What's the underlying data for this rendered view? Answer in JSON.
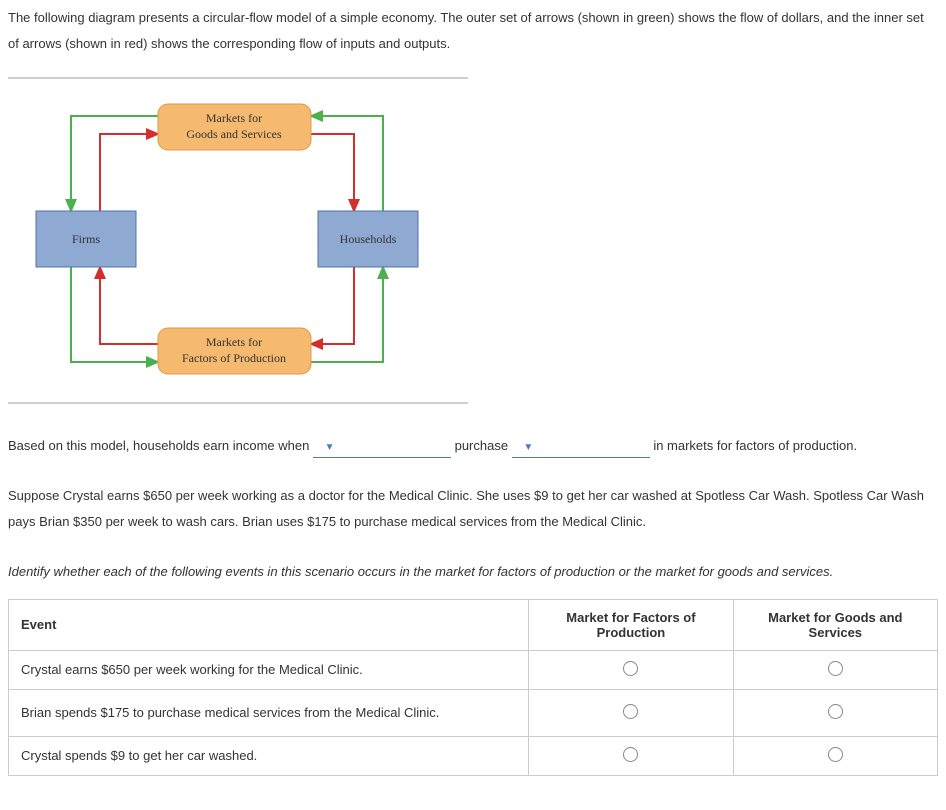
{
  "intro": "The following diagram presents a circular-flow model of a simple economy. The outer set of arrows (shown in green) shows the flow of dollars, and the inner set of arrows (shown in red) shows the corresponding flow of inputs and outputs.",
  "diagram": {
    "top_box": "Markets for\nGoods and Services",
    "left_box": "Firms",
    "right_box": "Households",
    "bottom_box": "Markets for\nFactors of Production"
  },
  "question": {
    "part1": "Based on this model, households earn income when ",
    "part2": " purchase ",
    "part3": " in markets for factors of production."
  },
  "scenario": "Suppose Crystal earns $650 per week working as a doctor for the Medical Clinic. She uses $9 to get her car washed at Spotless Car Wash. Spotless Car Wash pays Brian $350 per week to wash cars. Brian uses $175 to purchase medical services from the Medical Clinic.",
  "instruction": "Identify whether each of the following events in this scenario occurs in the market for factors of production or the market for goods and services.",
  "table": {
    "headers": {
      "event": "Event",
      "col1_a": "Market for Factors of",
      "col1_b": "Production",
      "col2_a": "Market for Goods and",
      "col2_b": "Services"
    },
    "rows": [
      "Crystal earns $650 per week working for the Medical Clinic.",
      "Brian spends $175 to purchase medical services from the Medical Clinic.",
      "Crystal spends $9 to get her car washed."
    ]
  }
}
